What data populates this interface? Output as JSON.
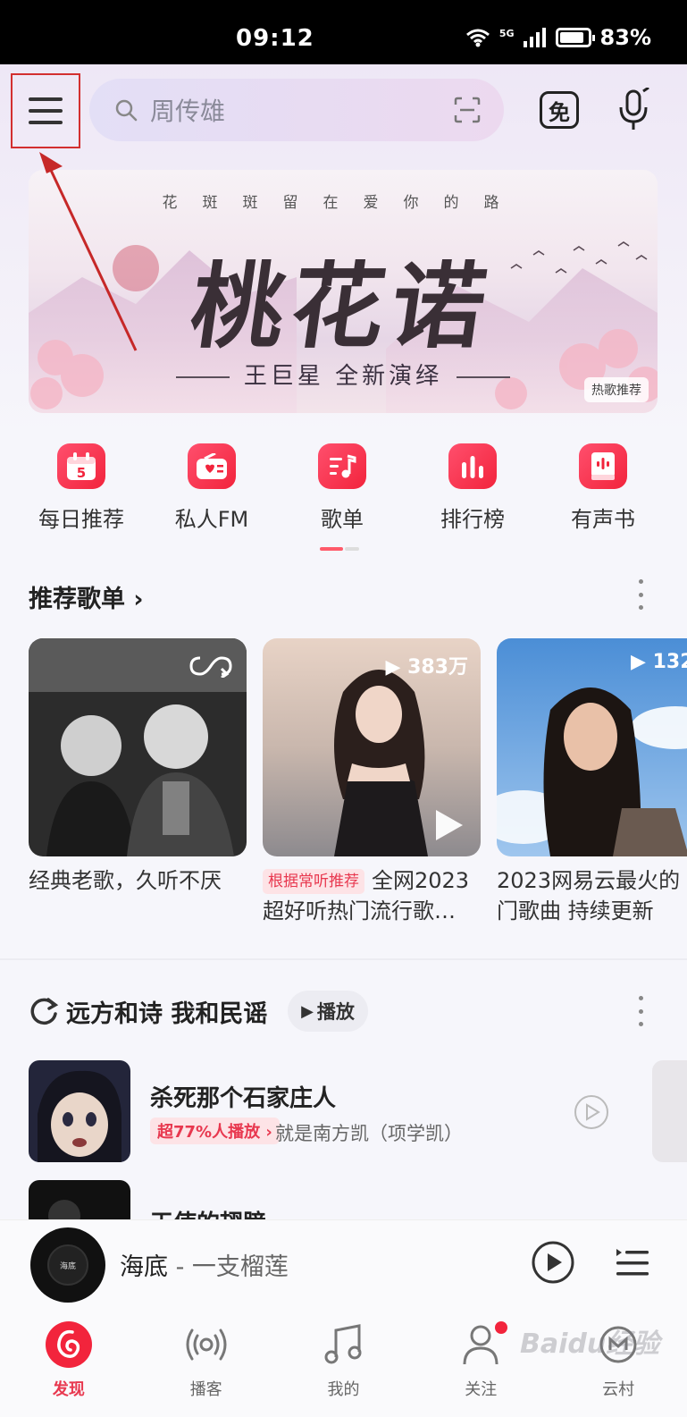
{
  "status_bar": {
    "time": "09:12",
    "network": "5G",
    "battery": "83%"
  },
  "header": {
    "search_placeholder": "周传雄",
    "free_icon_text": "免"
  },
  "banner": {
    "tagline": "花斑斑留在爱你的路",
    "title": "桃花诺",
    "subtitle": "王巨星 全新演绎",
    "badge": "热歌推荐"
  },
  "quick_nav": [
    {
      "label": "每日推荐",
      "icon": "calendar-icon",
      "icon_text": "5"
    },
    {
      "label": "私人FM",
      "icon": "radio-icon"
    },
    {
      "label": "歌单",
      "icon": "playlist-icon"
    },
    {
      "label": "排行榜",
      "icon": "chart-icon"
    },
    {
      "label": "有声书",
      "icon": "audiobook-icon"
    }
  ],
  "recommended": {
    "title": "推荐歌单",
    "cards": [
      {
        "text": "经典老歌，久听不厌"
      },
      {
        "play_count": "383万",
        "tag": "根据常听推荐",
        "text": "全网2023超好听热门流行歌…"
      },
      {
        "play_count": "132",
        "text": "2023网易云最火的门歌曲 持续更新"
      }
    ]
  },
  "folk_section": {
    "title": "远方和诗 我和民谣",
    "play_button": "播放",
    "songs": [
      {
        "title": "杀死那个石家庄人",
        "badge": "超77%人播放",
        "artist": "就是南方凯（项学凯）"
      },
      {
        "title": "天使的翅膀"
      }
    ]
  },
  "mini_player": {
    "song": "海底",
    "separator": " - ",
    "artist": "一支榴莲",
    "disc_text": "海底"
  },
  "bottom_nav": [
    {
      "label": "发现",
      "active": true
    },
    {
      "label": "播客"
    },
    {
      "label": "我的"
    },
    {
      "label": "关注"
    },
    {
      "label": "云村"
    }
  ],
  "watermark": "Baidu经验",
  "colors": {
    "accent": "#f2243c",
    "annotation": "#d32f2f"
  }
}
